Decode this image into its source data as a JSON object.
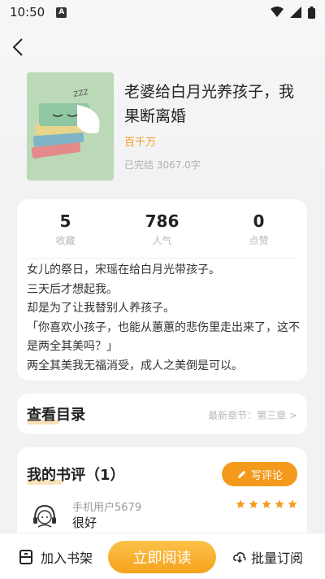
{
  "status_bar": {
    "time": "10:50",
    "indicator": "A",
    "icons": [
      "wifi-icon",
      "signal-icon",
      "battery-icon"
    ]
  },
  "book": {
    "title": "老婆给白月光养孩子，我果断离婚",
    "author": "百千万",
    "status": "已完结 3067.0字",
    "cover_text": "ZZZ"
  },
  "stats": [
    {
      "value": "5",
      "label": "收藏"
    },
    {
      "value": "786",
      "label": "人气"
    },
    {
      "value": "0",
      "label": "点赞"
    }
  ],
  "description": "女儿的祭日，宋瑶在给白月光带孩子。\n三天后才想起我。\n却是为了让我替别人养孩子。\n「你喜欢小孩子，也能从蕙蕙的悲伤里走出来了，这不是两全其美吗？」\n两全其美我无福消受，成人之美倒是可以。",
  "toc": {
    "title": "查看目录",
    "latest": "最新章节：第三章 >"
  },
  "reviews": {
    "title": "我的书评（1）",
    "write_label": "写评论",
    "items": [
      {
        "user": "手机用户5679",
        "text": "很好",
        "rating": 5
      }
    ]
  },
  "bottom_bar": {
    "shelf_label": "加入书架",
    "read_label": "立即阅读",
    "subscribe_label": "批量订阅"
  },
  "colors": {
    "accent": "#f39a1c",
    "cover_bg": "#bcd9b7"
  }
}
